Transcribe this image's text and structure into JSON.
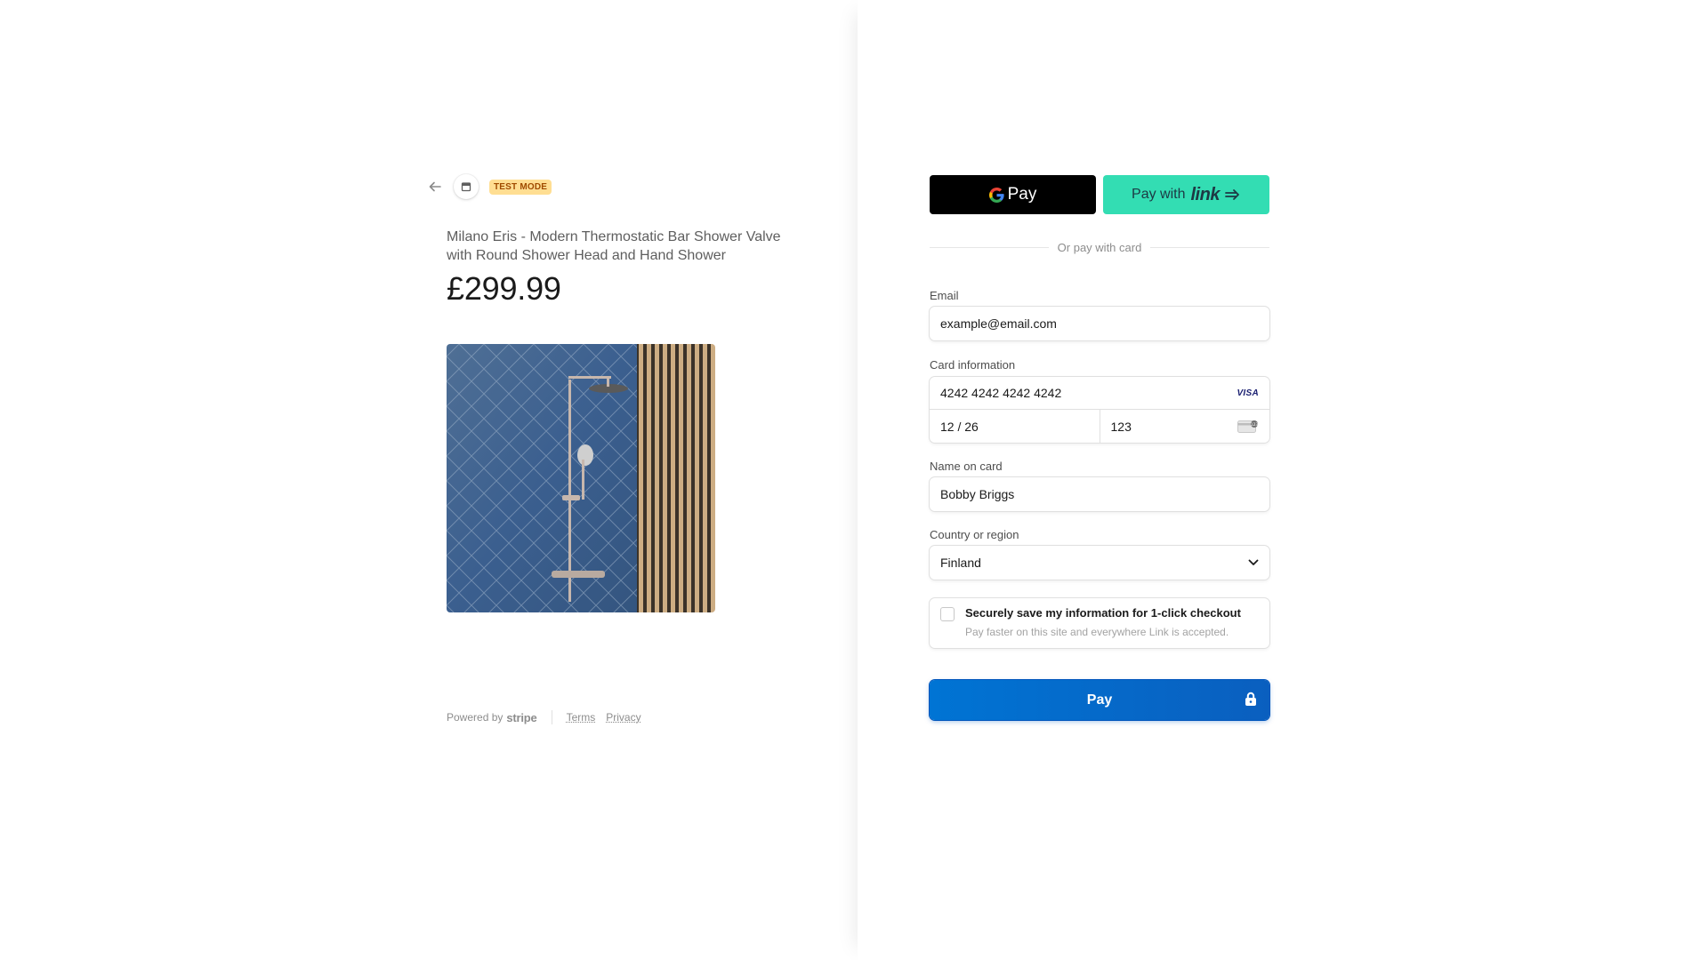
{
  "header": {
    "test_mode_label": "TEST MODE"
  },
  "product": {
    "name": "Milano Eris - Modern Thermostatic Bar Shower Valve with Round Shower Head and Hand Shower",
    "price": "£299.99"
  },
  "footer": {
    "powered_by": "Powered by",
    "stripe": "stripe",
    "terms": "Terms",
    "privacy": "Privacy"
  },
  "wallet": {
    "gpay_label": "Pay",
    "link_prefix": "Pay with",
    "link_word": "link"
  },
  "divider_text": "Or pay with card",
  "form": {
    "email_label": "Email",
    "email_value": "example@email.com",
    "card_label": "Card information",
    "card_number": "4242 4242 4242 4242",
    "card_brand": "VISA",
    "expiry": "12 / 26",
    "cvc": "123",
    "name_label": "Name on card",
    "name_value": "Bobby Briggs",
    "country_label": "Country or region",
    "country_value": "Finland"
  },
  "save_info": {
    "title": "Securely save my information for 1-click checkout",
    "subtitle": "Pay faster on this site and everywhere Link is accepted."
  },
  "pay_button": {
    "label": "Pay"
  },
  "colors": {
    "link_green": "#33ddb3",
    "pay_blue": "#0074d4",
    "test_badge_bg": "#ffde92",
    "test_badge_text": "#a04b00"
  },
  "icons": [
    "back-arrow-icon",
    "store-icon",
    "google-g-icon",
    "link-arrow-icon",
    "visa-icon",
    "cvc-card-icon",
    "chevron-down-icon",
    "lock-icon"
  ]
}
